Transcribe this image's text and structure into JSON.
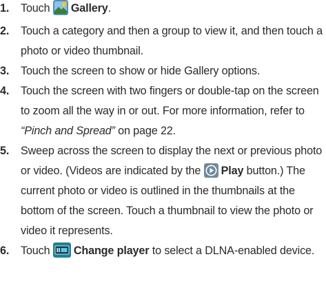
{
  "steps": [
    {
      "num": "1.",
      "pre": "Touch",
      "icon": "gallery-icon",
      "bold": "Gallery",
      "post": "."
    },
    {
      "num": "2.",
      "text": "Touch a category and then a group to view it, and then touch a photo or video thumbnail."
    },
    {
      "num": "3.",
      "text": "Touch the screen to show or hide Gallery options."
    },
    {
      "num": "4.",
      "pre": "Touch the screen with two fingers or double-tap on the screen to zoom all the way in or out. For more information, refer to",
      "italic": "“Pinch and Spread”",
      "post": " on page 22."
    },
    {
      "num": "5.",
      "pre": "Sweep across the screen to display the next or previous photo or video. (Videos are indicated by the",
      "icon": "play-icon",
      "bold": "Play",
      "post": " button.) The current photo or video is outlined in the thumbnails at the bottom of the screen. Touch a thumbnail to view the photo or video it represents."
    },
    {
      "num": "6.",
      "pre": "Touch",
      "icon": "change-player-icon",
      "bold": "Change player",
      "post": " to select a DLNA-enabled device."
    }
  ],
  "colors": {
    "number": "#2b2b2b",
    "text": "#2b2b2b",
    "gallery_icon_bg": "#4a90c8",
    "play_icon_bg": "#6f8a9c",
    "player_icon_bg": "#1f7f9a"
  }
}
